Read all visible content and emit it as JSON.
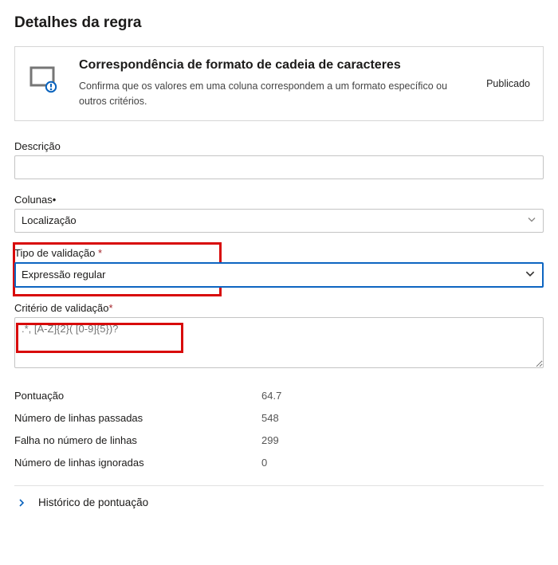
{
  "page": {
    "title": "Detalhes da regra"
  },
  "card": {
    "title": "Correspondência de formato de cadeia de caracteres",
    "description": "Confirma que os valores em uma coluna correspondem a um formato específico ou outros critérios.",
    "status_badge": "Publicado"
  },
  "fields": {
    "description": {
      "label": "Descrição",
      "value": ""
    },
    "columns": {
      "label": "Colunas",
      "required_marker": "•",
      "value": "Localização"
    },
    "validation_type": {
      "label": "Tipo de validação",
      "value": "Expressão regular"
    },
    "validation_criteria": {
      "label": "Critério de validação",
      "placeholder": ".*, [A-Z]{2}( [0-9]{5})?"
    }
  },
  "stats": {
    "rows": [
      {
        "label": "Pontuação",
        "value": "64.7"
      },
      {
        "label": "Número de linhas passadas",
        "value": "548"
      },
      {
        "label": "Falha no número de linhas",
        "value": "299"
      },
      {
        "label": "Número de linhas ignoradas",
        "value": "0"
      }
    ]
  },
  "accordion": {
    "title": "Histórico de pontuação"
  },
  "required_star": "*"
}
